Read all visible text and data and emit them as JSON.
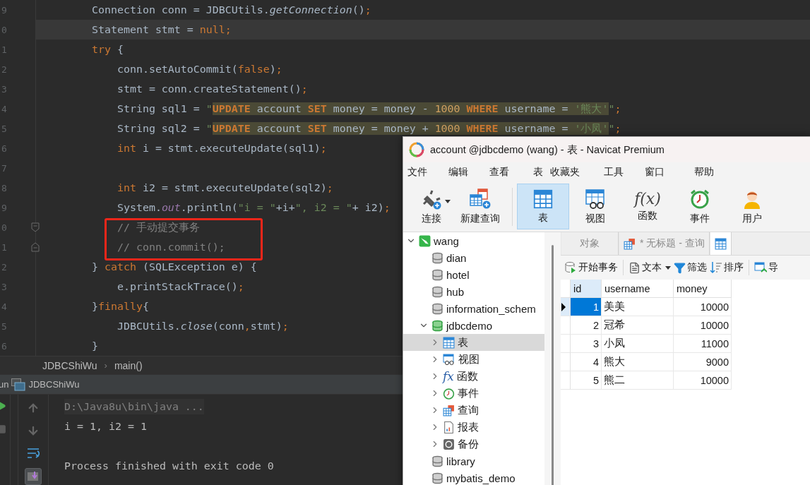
{
  "editor": {
    "lines": [
      {
        "number": "9",
        "current": false,
        "boxed": false,
        "tokens": [
          {
            "text": "        Connection conn = JDBCUtils.",
            "kind": "plain"
          },
          {
            "text": "getConnection",
            "kind": "static-call"
          },
          {
            "text": "()",
            "kind": "plain"
          },
          {
            "text": ";",
            "kind": "keyword"
          }
        ]
      },
      {
        "number": "0",
        "current": true,
        "boxed": false,
        "tokens": [
          {
            "text": "        Statement stmt = ",
            "kind": "plain"
          },
          {
            "text": "null;",
            "kind": "keyword"
          }
        ]
      },
      {
        "number": "1",
        "current": false,
        "boxed": false,
        "tokens": [
          {
            "text": "        try",
            "kind": "keyword"
          },
          {
            "text": " {",
            "kind": "plain"
          }
        ]
      },
      {
        "number": "2",
        "current": false,
        "boxed": false,
        "tokens": [
          {
            "text": "            conn.setAutoCommit(",
            "kind": "plain"
          },
          {
            "text": "false",
            "kind": "keyword"
          },
          {
            "text": ")",
            "kind": "plain"
          },
          {
            "text": ";",
            "kind": "keyword"
          }
        ]
      },
      {
        "number": "3",
        "current": false,
        "boxed": false,
        "tokens": [
          {
            "text": "            stmt = conn.createStatement()",
            "kind": "plain"
          },
          {
            "text": ";",
            "kind": "keyword"
          }
        ]
      },
      {
        "number": "4",
        "current": false,
        "boxed": false,
        "tokens": [
          {
            "text": "            String sql1 = ",
            "kind": "plain"
          },
          {
            "text": "\"",
            "kind": "string"
          },
          {
            "text": "UPDATE",
            "kind": "sql-keyword"
          },
          {
            "text": " account ",
            "kind": "sql"
          },
          {
            "text": "SET",
            "kind": "sql-keyword"
          },
          {
            "text": " money = money - ",
            "kind": "sql"
          },
          {
            "text": "1000",
            "kind": "sql-number"
          },
          {
            "text": " WHERE",
            "kind": "sql-keyword"
          },
          {
            "text": " username = ",
            "kind": "sql"
          },
          {
            "text": "'熊大'",
            "kind": "sql-string"
          },
          {
            "text": "\"",
            "kind": "string"
          },
          {
            "text": ";",
            "kind": "keyword"
          }
        ]
      },
      {
        "number": "5",
        "current": false,
        "boxed": false,
        "tokens": [
          {
            "text": "            String sql2 = ",
            "kind": "plain"
          },
          {
            "text": "\"",
            "kind": "string"
          },
          {
            "text": "UPDATE",
            "kind": "sql-keyword"
          },
          {
            "text": " account ",
            "kind": "sql"
          },
          {
            "text": "SET",
            "kind": "sql-keyword"
          },
          {
            "text": " money = money + ",
            "kind": "sql"
          },
          {
            "text": "1000",
            "kind": "sql-number"
          },
          {
            "text": " WHERE",
            "kind": "sql-keyword"
          },
          {
            "text": " username = ",
            "kind": "sql"
          },
          {
            "text": "'小凤'",
            "kind": "sql-string"
          },
          {
            "text": "\"",
            "kind": "string"
          },
          {
            "text": ";",
            "kind": "keyword"
          }
        ]
      },
      {
        "number": "6",
        "current": false,
        "boxed": false,
        "tokens": [
          {
            "text": "            int",
            "kind": "keyword"
          },
          {
            "text": " i = stmt.executeUpdate(sql1)",
            "kind": "plain"
          },
          {
            "text": ";",
            "kind": "keyword"
          }
        ]
      },
      {
        "number": "7",
        "current": false,
        "boxed": false
      },
      {
        "number": "8",
        "current": false,
        "boxed": false,
        "tokens": [
          {
            "text": "            int",
            "kind": "keyword"
          },
          {
            "text": " i2 = stmt.executeUpdate(sql2)",
            "kind": "plain"
          },
          {
            "text": ";",
            "kind": "keyword"
          }
        ]
      },
      {
        "number": "9",
        "current": false,
        "boxed": false,
        "tokens": [
          {
            "text": "            System.",
            "kind": "plain"
          },
          {
            "text": "out",
            "kind": "static-field"
          },
          {
            "text": ".println(",
            "kind": "plain"
          },
          {
            "text": "\"i = \"",
            "kind": "string"
          },
          {
            "text": "+i+",
            "kind": "plain"
          },
          {
            "text": "\", i2 = \"",
            "kind": "string"
          },
          {
            "text": "+ i2)",
            "kind": "plain"
          },
          {
            "text": ";",
            "kind": "keyword"
          }
        ]
      },
      {
        "number": "0",
        "current": false,
        "boxed": true,
        "foldable": true,
        "tokens": [
          {
            "text": "            // 手动提交事务",
            "kind": "comment"
          }
        ]
      },
      {
        "number": "1",
        "current": false,
        "boxed": true,
        "foldable": true,
        "tokens": [
          {
            "text": "            // conn.commit();",
            "kind": "comment"
          }
        ]
      },
      {
        "number": "2",
        "current": false,
        "boxed": false,
        "tokens": [
          {
            "text": "        } ",
            "kind": "plain"
          },
          {
            "text": "catch",
            "kind": "keyword"
          },
          {
            "text": " (SQLException e) {",
            "kind": "plain"
          }
        ]
      },
      {
        "number": "3",
        "current": false,
        "boxed": false,
        "tokens": [
          {
            "text": "            e.printStackTrace()",
            "kind": "plain"
          },
          {
            "text": ";",
            "kind": "keyword"
          }
        ]
      },
      {
        "number": "4",
        "current": false,
        "boxed": false,
        "tokens": [
          {
            "text": "        }",
            "kind": "plain"
          },
          {
            "text": "finally",
            "kind": "keyword"
          },
          {
            "text": "{",
            "kind": "plain"
          }
        ]
      },
      {
        "number": "5",
        "current": false,
        "boxed": false,
        "tokens": [
          {
            "text": "            JDBCUtils.",
            "kind": "plain"
          },
          {
            "text": "close",
            "kind": "static-call"
          },
          {
            "text": "(conn",
            "kind": "plain"
          },
          {
            "text": ",",
            "kind": "keyword"
          },
          {
            "text": "stmt)",
            "kind": "plain"
          },
          {
            "text": ";",
            "kind": "keyword"
          }
        ]
      },
      {
        "number": "6",
        "current": false,
        "boxed": false,
        "tokens": [
          {
            "text": "        }",
            "kind": "plain"
          }
        ]
      }
    ]
  },
  "breadcrumb": {
    "items": [
      "JDBCShiWu",
      "main()"
    ],
    "separator": "›"
  },
  "run_panel": {
    "label": "un",
    "config": "JDBCShiWu",
    "console": [
      {
        "text": "D:\\Java8u\\bin\\java ...",
        "kind": "command"
      },
      {
        "text": "i = 1, i2 = 1",
        "kind": "output"
      },
      {
        "kind": "blank"
      },
      {
        "text": "Process finished with exit code 0",
        "kind": "output"
      }
    ]
  },
  "navicat": {
    "title": "account @jdbcdemo (wang) - 表 - Navicat Premium",
    "menu": [
      "文件",
      "编辑",
      "查看",
      "表",
      "收藏夹",
      "工具",
      "窗口",
      "帮助"
    ],
    "toolbar": [
      {
        "label": "连接",
        "kind": "connect",
        "selected": false,
        "dropdown": true
      },
      {
        "label": "新建查询",
        "kind": "query",
        "selected": false,
        "dropdown": false
      },
      {
        "label": "表",
        "kind": "table",
        "selected": true,
        "dropdown": false
      },
      {
        "label": "视图",
        "kind": "view",
        "selected": false,
        "dropdown": false
      },
      {
        "label": "函数",
        "kind": "function",
        "selected": false,
        "dropdown": false,
        "glyph": "f(x)"
      },
      {
        "label": "事件",
        "kind": "event",
        "selected": false,
        "dropdown": false
      },
      {
        "label": "用户",
        "kind": "user",
        "selected": false,
        "dropdown": false
      }
    ],
    "tree": [
      {
        "label": "wang",
        "kind": "connection",
        "expanded": true,
        "selected": false,
        "children": [
          {
            "label": "dian",
            "kind": "database",
            "open": false,
            "selected": false
          },
          {
            "label": "hotel",
            "kind": "database",
            "open": false,
            "selected": false
          },
          {
            "label": "hub",
            "kind": "database",
            "open": false,
            "selected": false
          },
          {
            "label": "information_schem",
            "kind": "database",
            "open": false,
            "selected": false
          },
          {
            "label": "jdbcdemo",
            "kind": "database",
            "open": true,
            "expanded": true,
            "selected": false,
            "children": [
              {
                "label": "表",
                "kind": "table",
                "expanded": false,
                "selected": true
              },
              {
                "label": "视图",
                "kind": "view",
                "expanded": false,
                "selected": false
              },
              {
                "label": "函数",
                "kind": "function",
                "expanded": false,
                "selected": false,
                "glyph": "fx"
              },
              {
                "label": "事件",
                "kind": "event",
                "expanded": false,
                "selected": false
              },
              {
                "label": "查询",
                "kind": "query",
                "expanded": false,
                "selected": false
              },
              {
                "label": "报表",
                "kind": "report",
                "expanded": false,
                "selected": false
              },
              {
                "label": "备份",
                "kind": "backup",
                "expanded": false,
                "selected": false
              }
            ]
          },
          {
            "label": "library",
            "kind": "database",
            "open": false,
            "selected": false
          },
          {
            "label": "mybatis_demo",
            "kind": "database",
            "open": false,
            "selected": false
          }
        ]
      }
    ],
    "tabs": [
      {
        "label": "对象",
        "kind": "objects",
        "selected": false
      },
      {
        "label": "* 无标题 - 查询",
        "kind": "query",
        "selected": false
      },
      {
        "kind": "table",
        "selected": true
      }
    ],
    "actions": [
      {
        "label": "开始事务",
        "kind": "transaction",
        "dropdown": false
      },
      {
        "label": "文本",
        "kind": "text",
        "dropdown": true
      },
      {
        "label": "筛选",
        "kind": "filter",
        "dropdown": false
      },
      {
        "label": "排序",
        "kind": "sort",
        "dropdown": false
      },
      {
        "label": "导",
        "kind": "import",
        "dropdown": false
      }
    ],
    "table": {
      "columns": [
        {
          "label": "id",
          "selected": true
        },
        {
          "label": "username",
          "selected": false
        },
        {
          "label": "money",
          "selected": false
        }
      ],
      "rows": [
        {
          "id": "1",
          "username": "美美",
          "money": "10000",
          "selected": true
        },
        {
          "id": "2",
          "username": "冠希",
          "money": "10000",
          "selected": false
        },
        {
          "id": "3",
          "username": "小凤",
          "money": "11000",
          "selected": false
        },
        {
          "id": "4",
          "username": "熊大",
          "money": "9000",
          "selected": false
        },
        {
          "id": "5",
          "username": "熊二",
          "money": "10000",
          "selected": false
        }
      ]
    }
  }
}
